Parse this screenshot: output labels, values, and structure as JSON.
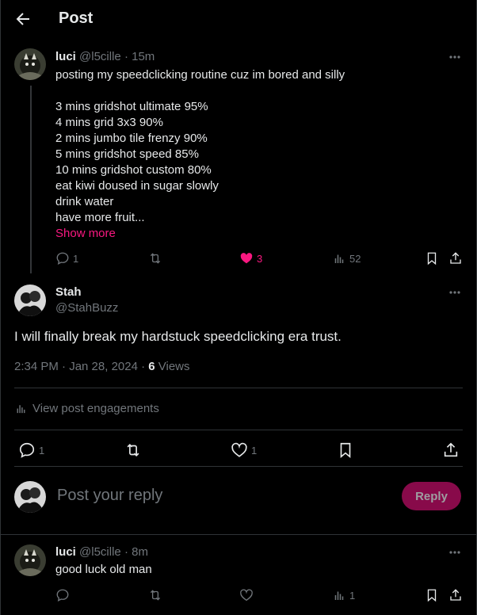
{
  "header": {
    "title": "Post"
  },
  "parent_post": {
    "name": "luci",
    "handle": "@l5cille",
    "time": "15m",
    "lines": [
      "posting my speedclicking routine cuz im bored and silly",
      "",
      "3 mins gridshot ultimate 95%",
      "4 mins grid 3x3 90%",
      "2 mins jumbo tile frenzy 90%",
      "5 mins gridshot speed 85%",
      "10 mins gridshot custom 80%",
      "eat kiwi doused in sugar slowly",
      "drink water",
      "have more fruit..."
    ],
    "show_more": "Show more",
    "replies": "1",
    "likes": "3",
    "views": "52"
  },
  "main_post": {
    "name": "Stah",
    "handle": "@StahBuzz",
    "text": "I will finally break my hardstuck speedclicking era trust.",
    "timestamp": "2:34 PM · Jan 28, 2024 · ",
    "views_count": "6",
    "views_label": " Views",
    "engagements": "View post engagements",
    "replies": "1",
    "likes": "1"
  },
  "composer": {
    "placeholder": "Post your reply",
    "button": "Reply"
  },
  "reply_post": {
    "name": "luci",
    "handle": "@l5cille",
    "time": "8m",
    "text": "good luck old man",
    "views": "1"
  },
  "colors": {
    "accent_pink": "#f91880",
    "muted": "#71767b",
    "text": "#e7e9ea",
    "divider": "#2f3336"
  }
}
